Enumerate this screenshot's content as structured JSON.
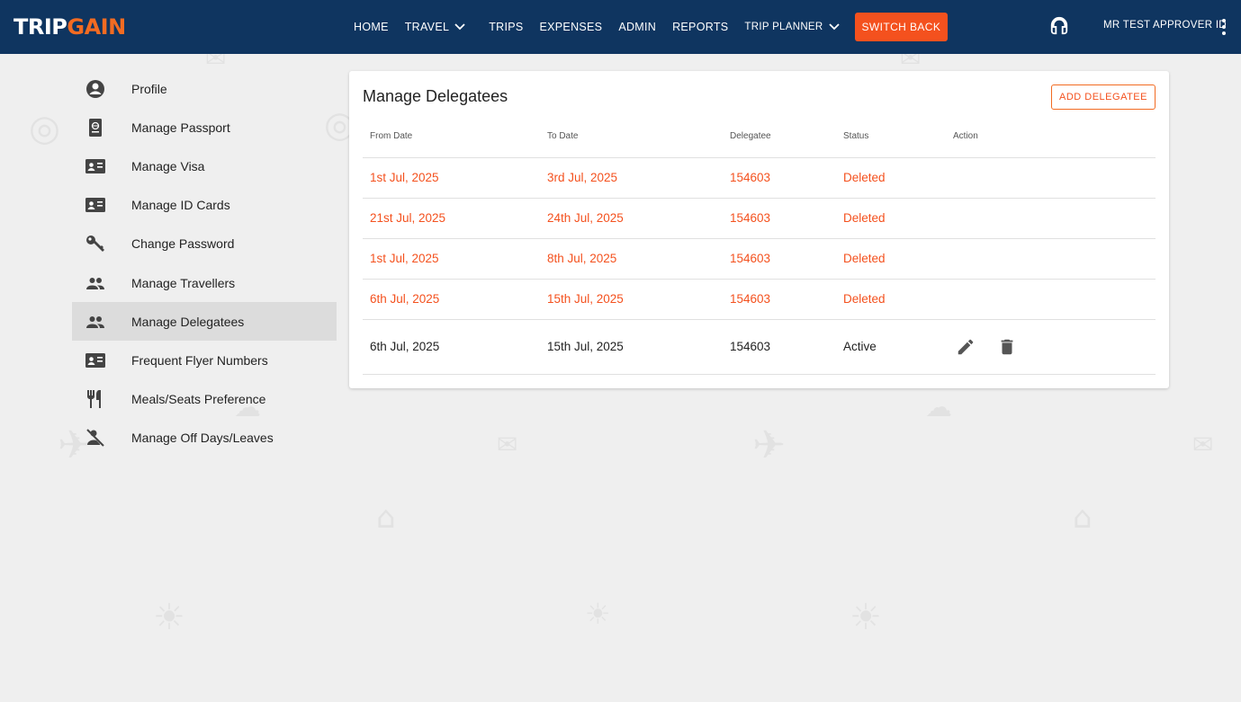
{
  "brand": {
    "logo_part1": "TRIP",
    "logo_part2": "GAIN"
  },
  "nav": {
    "items": [
      {
        "label": "HOME"
      },
      {
        "label": "TRAVEL"
      },
      {
        "label": "TRIPS"
      },
      {
        "label": "EXPENSES"
      },
      {
        "label": "ADMIN"
      },
      {
        "label": "REPORTS"
      },
      {
        "label": "TRIP PLANNER"
      }
    ],
    "switch_back": "SWITCH BACK",
    "user": "MR TEST APPROVER ID"
  },
  "sidebar": {
    "items": [
      {
        "label": "Profile",
        "icon": "account-circle-icon"
      },
      {
        "label": "Manage Passport",
        "icon": "passport-icon"
      },
      {
        "label": "Manage Visa",
        "icon": "id-card-icon"
      },
      {
        "label": "Manage ID Cards",
        "icon": "id-card-icon"
      },
      {
        "label": "Change Password",
        "icon": "key-icon"
      },
      {
        "label": "Manage Travellers",
        "icon": "people-icon"
      },
      {
        "label": "Manage Delegatees",
        "icon": "people-icon"
      },
      {
        "label": "Frequent Flyer Numbers",
        "icon": "id-card-icon"
      },
      {
        "label": "Meals/Seats Preference",
        "icon": "restaurant-icon"
      },
      {
        "label": "Manage Off Days/Leaves",
        "icon": "person-off-icon"
      }
    ],
    "active": "Manage Delegatees"
  },
  "main": {
    "title": "Manage Delegatees",
    "add_button": "ADD DELEGATEE",
    "columns": [
      "From Date",
      "To Date",
      "Delegatee",
      "Status",
      "Action"
    ],
    "rows": [
      {
        "from": "1st Jul, 2025",
        "to": "3rd Jul, 2025",
        "delegatee": "154603",
        "status": "Deleted"
      },
      {
        "from": "21st Jul, 2025",
        "to": "24th Jul, 2025",
        "delegatee": "154603",
        "status": "Deleted"
      },
      {
        "from": "1st Jul, 2025",
        "to": "8th Jul, 2025",
        "delegatee": "154603",
        "status": "Deleted"
      },
      {
        "from": "6th Jul, 2025",
        "to": "15th Jul, 2025",
        "delegatee": "154603",
        "status": "Deleted"
      },
      {
        "from": "6th Jul, 2025",
        "to": "15th Jul, 2025",
        "delegatee": "154603",
        "status": "Active"
      }
    ]
  },
  "colors": {
    "navbar": "#0f3560",
    "accent": "#f4511e",
    "deleted_text": "#f4511e",
    "background": "#efefef"
  }
}
